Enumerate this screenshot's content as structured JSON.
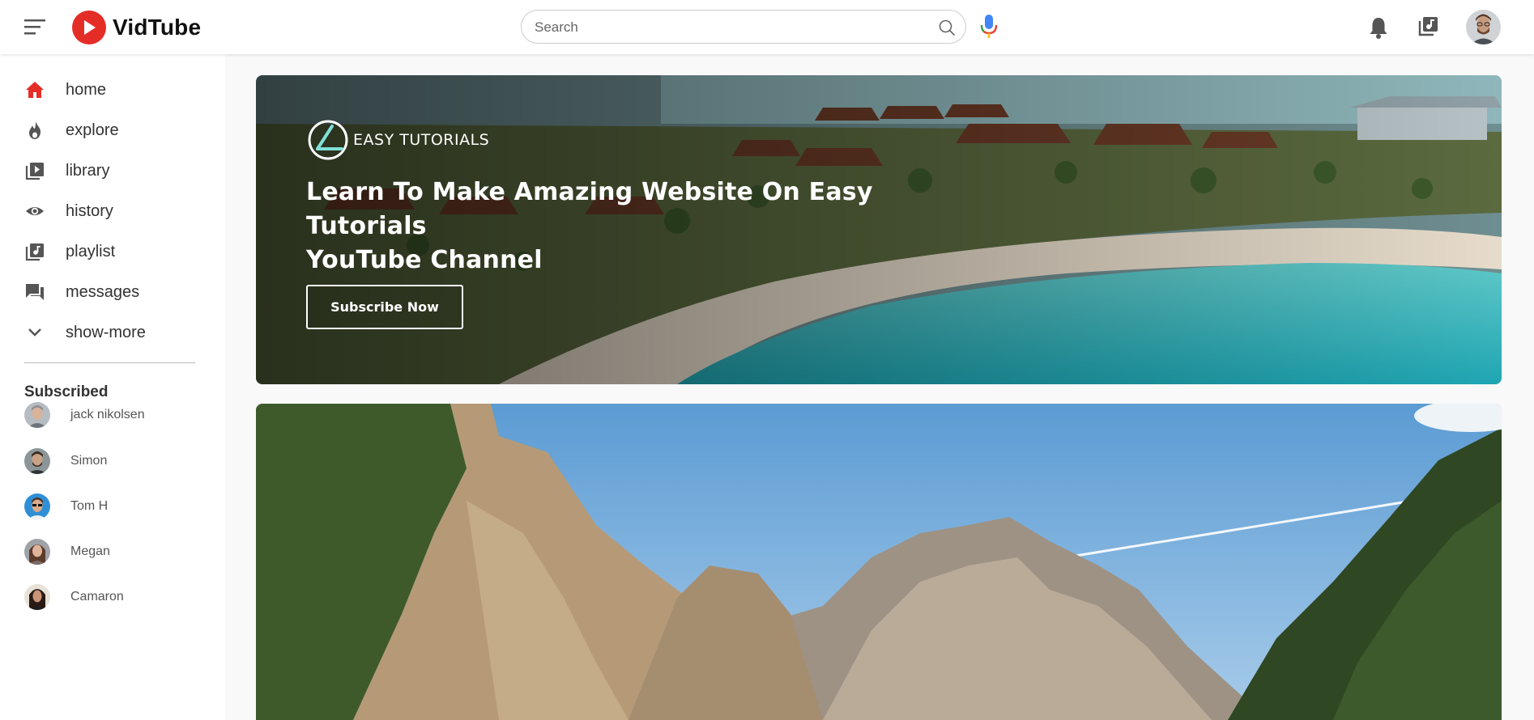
{
  "header": {
    "logo_text": "VidTube",
    "search": {
      "placeholder": "Search",
      "value": ""
    }
  },
  "sidebar": {
    "items": [
      {
        "label": "home",
        "icon": "home-icon",
        "active": true
      },
      {
        "label": "explore",
        "icon": "explore-icon"
      },
      {
        "label": "library",
        "icon": "library-icon"
      },
      {
        "label": "history",
        "icon": "history-icon"
      },
      {
        "label": "playlist",
        "icon": "playlist-icon"
      },
      {
        "label": "messages",
        "icon": "messages-icon"
      },
      {
        "label": "show-more",
        "icon": "chevron-down-icon"
      }
    ],
    "subscribed_title": "Subscribed",
    "subscriptions": [
      {
        "name": "jack nikolsen"
      },
      {
        "name": "Simon"
      },
      {
        "name": "Tom H"
      },
      {
        "name": "Megan"
      },
      {
        "name": "Camaron"
      }
    ]
  },
  "banner": {
    "brand": "EASY TUTORIALS",
    "heading_line1": "Learn To Make Amazing Website On Easy Tutorials",
    "heading_line2": "YouTube Channel",
    "button_label": "Subscribe Now"
  },
  "colors": {
    "brand_red": "#e52d27",
    "active_icon": "#e52d27",
    "sea": "#35b8c0",
    "banner_logo_accent": "#7fe0d8"
  }
}
